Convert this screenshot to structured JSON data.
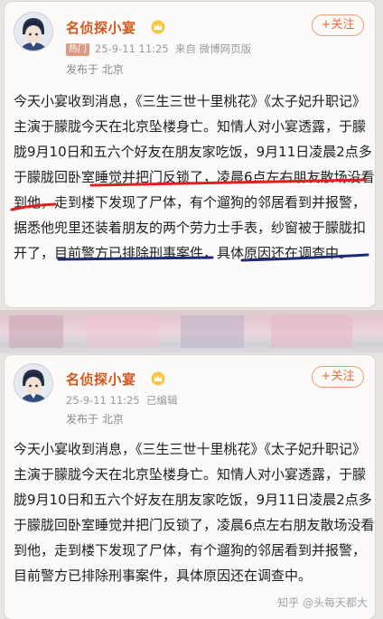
{
  "post_top": {
    "author": "名侦探小宴",
    "follow_label": "+关注",
    "hot_badge": "热门",
    "timestamp": "25-9-11 11:25",
    "source": "来自 微博网页版",
    "location": "发布于 北京",
    "body": "今天小宴收到消息，《三生三世十里桃花》《太子妃升职记》主演于朦胧今天在北京坠楼身亡。知情人对小宴透露，于朦胧9月10日和五六个好友在朋友家吃饭，9月11日凌晨2点多于朦胧回卧室睡觉并把门反锁了，凌晨6点左右朋友散场没看到他，走到楼下发现了尸体，有个遛狗的邻居看到并报警，据悉他兜里还装着朋友的两个劳力士手表，纱窗被于朦胧扣开了，目前警方已排除刑事案件，具体原因还在调查中。"
  },
  "post_bottom": {
    "author": "名侦探小宴",
    "follow_label": "+关注",
    "timestamp": "25-9-11 11:25",
    "source": "已编辑",
    "location": "发布于 北京",
    "body": "今天小宴收到消息，《三生三世十里桃花》《太子妃升职记》主演于朦胧今天在北京坠楼身亡。知情人对小宴透露，于朦胧9月10日和五六个好友在朋友家吃饭，9月11日凌晨2点多于朦胧回卧室睡觉并把门反锁了，凌晨6点左右朋友散场没看到他，走到楼下发现了尸体，有个遛狗的邻居看到并报警，目前警方已排除刑事案件，具体原因还在调查中。"
  },
  "watermark": "知乎 @头每天都大",
  "colors": {
    "author": "#d0561e",
    "follow": "#ee6b34",
    "hot_badge": "#d99a86",
    "annotation_red": "#e02020",
    "annotation_navy": "#1e2a78"
  },
  "icons": [
    "crown-verified-icon",
    "avatar"
  ]
}
